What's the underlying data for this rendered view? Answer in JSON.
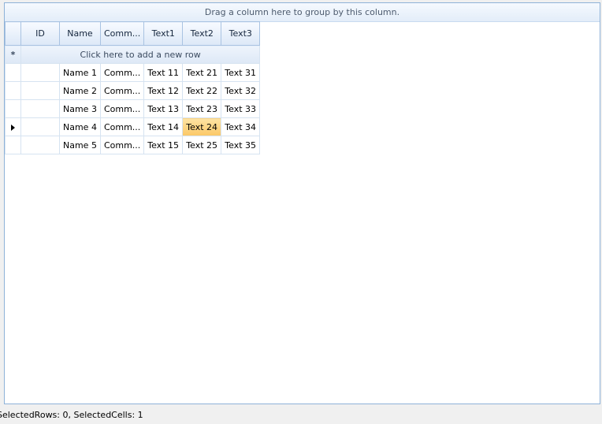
{
  "group_panel": {
    "text": "Drag a column here to group by this column."
  },
  "grid": {
    "columns": [
      "ID",
      "Name",
      "Comm...",
      "Text1",
      "Text2",
      "Text3"
    ],
    "new_row_text": "Click here to add a new row",
    "new_row_marker": "*",
    "current_row_index": 3,
    "selected_cell": {
      "row": 3,
      "column": "Text2"
    },
    "rows": [
      {
        "id": "",
        "name": "Name 1",
        "comment": "Comm...",
        "text1": "Text 11",
        "text2": "Text 21",
        "text3": "Text 31"
      },
      {
        "id": "",
        "name": "Name 2",
        "comment": "Comm...",
        "text1": "Text 12",
        "text2": "Text 22",
        "text3": "Text 32"
      },
      {
        "id": "",
        "name": "Name 3",
        "comment": "Comm...",
        "text1": "Text 13",
        "text2": "Text 23",
        "text3": "Text 33"
      },
      {
        "id": "",
        "name": "Name 4",
        "comment": "Comm...",
        "text1": "Text 14",
        "text2": "Text 24",
        "text3": "Text 34"
      },
      {
        "id": "",
        "name": "Name 5",
        "comment": "Comm...",
        "text1": "Text 15",
        "text2": "Text 25",
        "text3": "Text 35"
      }
    ]
  },
  "status_bar": {
    "text": "SelectedRows: 0, SelectedCells: 1"
  },
  "colors": {
    "accent_border": "#8eb2d8",
    "selected_cell": "#fbc867"
  }
}
